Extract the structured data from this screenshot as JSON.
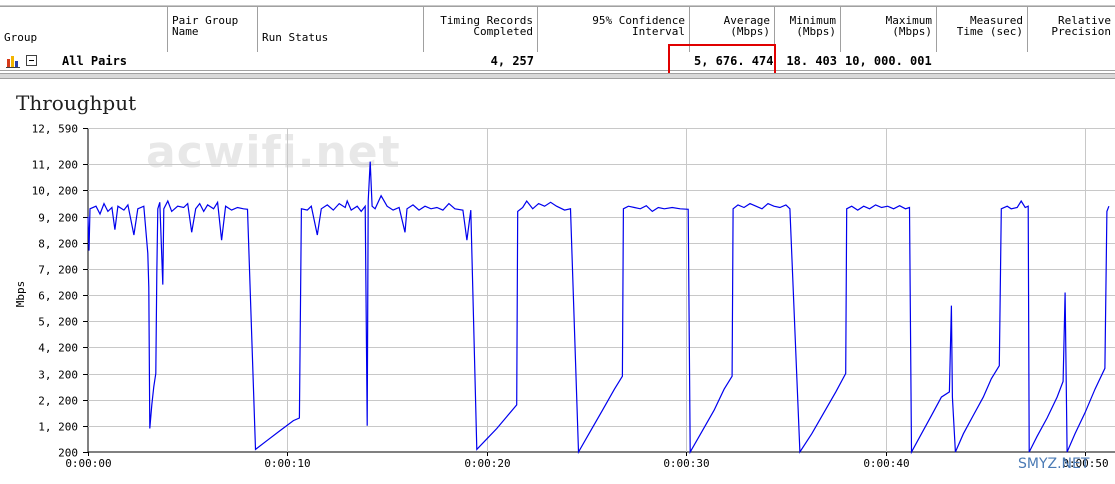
{
  "table": {
    "headers": [
      {
        "key": "group",
        "label": "Group",
        "align": "left",
        "valign": "bottom"
      },
      {
        "key": "pair_group_name",
        "label": "Pair Group\nName",
        "align": "left",
        "valign": "top"
      },
      {
        "key": "run_status",
        "label": "Run Status",
        "align": "left",
        "valign": "bottom"
      },
      {
        "key": "timing_records",
        "label": "Timing Records\nCompleted",
        "align": "right",
        "valign": "top"
      },
      {
        "key": "confidence",
        "label": "95% Confidence\nInterval",
        "align": "right",
        "valign": "top"
      },
      {
        "key": "average",
        "label": "Average\n(Mbps)",
        "align": "right",
        "valign": "top"
      },
      {
        "key": "minimum",
        "label": "Minimum\n(Mbps)",
        "align": "right",
        "valign": "top"
      },
      {
        "key": "maximum",
        "label": "Maximum\n(Mbps)",
        "align": "right",
        "valign": "top"
      },
      {
        "key": "measured_time",
        "label": "Measured\nTime (sec)",
        "align": "right",
        "valign": "top"
      },
      {
        "key": "relative_precision",
        "label": "Relative\nPrecision",
        "align": "right",
        "valign": "top"
      }
    ],
    "row": {
      "group": "All Pairs",
      "timing_records": "4, 257",
      "average": "5, 676. 474",
      "minimum": "18. 403",
      "maximum": "10, 000. 001"
    }
  },
  "chart_title": "Throughput",
  "watermark": "acwifi.net",
  "corner_mark": "SMYZ.NET",
  "colors": {
    "series": "#0000ee",
    "highlight": "#e00000",
    "grid": "#c8c8c8"
  },
  "chart_data": {
    "type": "line",
    "title": "Throughput",
    "ylabel": "Mbps",
    "xlabel": "",
    "ylim": [
      200,
      12590
    ],
    "xlim": [
      0,
      50
    ],
    "yticks": [
      200,
      1200,
      2200,
      3200,
      4200,
      5200,
      6200,
      7200,
      8200,
      9200,
      10200,
      11200,
      12590
    ],
    "ytick_labels": [
      "200",
      "1, 200",
      "2, 200",
      "3, 200",
      "4, 200",
      "5, 200",
      "6, 200",
      "7, 200",
      "8, 200",
      "9, 200",
      "10, 200",
      "11, 200",
      "12, 590"
    ],
    "xticks": [
      0,
      10,
      20,
      30,
      40,
      50
    ],
    "xtick_labels": [
      "0:00:00",
      "0:00:10",
      "0:00:20",
      "0:00:30",
      "0:00:40",
      "0:00:50"
    ],
    "grid": true,
    "series": [
      {
        "values": [
          [
            0,
            9200
          ],
          [
            0.05,
            7900
          ],
          [
            0.1,
            9500
          ],
          [
            0.4,
            9600
          ],
          [
            0.6,
            9300
          ],
          [
            0.8,
            9700
          ],
          [
            1.0,
            9400
          ],
          [
            1.2,
            9550
          ],
          [
            1.35,
            8700
          ],
          [
            1.5,
            9600
          ],
          [
            1.8,
            9450
          ],
          [
            2.0,
            9650
          ],
          [
            2.3,
            8500
          ],
          [
            2.5,
            9500
          ],
          [
            2.8,
            9600
          ],
          [
            3.0,
            7800
          ],
          [
            3.05,
            6500
          ],
          [
            3.1,
            1100
          ],
          [
            3.2,
            2000
          ],
          [
            3.3,
            2700
          ],
          [
            3.4,
            3200
          ],
          [
            3.45,
            7000
          ],
          [
            3.5,
            9500
          ],
          [
            3.6,
            9750
          ],
          [
            3.75,
            6600
          ],
          [
            3.8,
            9500
          ],
          [
            4.0,
            9800
          ],
          [
            4.2,
            9400
          ],
          [
            4.5,
            9600
          ],
          [
            4.8,
            9550
          ],
          [
            5.0,
            9700
          ],
          [
            5.2,
            8600
          ],
          [
            5.4,
            9500
          ],
          [
            5.6,
            9700
          ],
          [
            5.8,
            9400
          ],
          [
            6.0,
            9650
          ],
          [
            6.3,
            9500
          ],
          [
            6.5,
            9750
          ],
          [
            6.7,
            8300
          ],
          [
            6.9,
            9600
          ],
          [
            7.2,
            9450
          ],
          [
            7.5,
            9550
          ],
          [
            7.8,
            9500
          ],
          [
            8.0,
            9480
          ],
          [
            8.4,
            300
          ],
          [
            9.0,
            650
          ],
          [
            9.6,
            1000
          ],
          [
            10.3,
            1400
          ],
          [
            10.6,
            1500
          ],
          [
            10.7,
            9500
          ],
          [
            11.0,
            9450
          ],
          [
            11.2,
            9600
          ],
          [
            11.5,
            8500
          ],
          [
            11.7,
            9500
          ],
          [
            12.0,
            9650
          ],
          [
            12.3,
            9450
          ],
          [
            12.6,
            9700
          ],
          [
            12.9,
            9550
          ],
          [
            13.0,
            9800
          ],
          [
            13.2,
            9450
          ],
          [
            13.5,
            9600
          ],
          [
            13.7,
            9400
          ],
          [
            13.9,
            9600
          ],
          [
            14.0,
            1200
          ],
          [
            14.05,
            9800
          ],
          [
            14.15,
            11300
          ],
          [
            14.25,
            9600
          ],
          [
            14.4,
            9500
          ],
          [
            14.7,
            10000
          ],
          [
            15.0,
            9600
          ],
          [
            15.3,
            9450
          ],
          [
            15.6,
            9550
          ],
          [
            15.9,
            8600
          ],
          [
            16.0,
            9500
          ],
          [
            16.3,
            9650
          ],
          [
            16.6,
            9450
          ],
          [
            16.9,
            9600
          ],
          [
            17.2,
            9500
          ],
          [
            17.5,
            9550
          ],
          [
            17.8,
            9450
          ],
          [
            18.1,
            9700
          ],
          [
            18.4,
            9500
          ],
          [
            18.8,
            9450
          ],
          [
            19.0,
            8300
          ],
          [
            19.2,
            9450
          ],
          [
            19.5,
            300
          ],
          [
            20.0,
            700
          ],
          [
            20.5,
            1100
          ],
          [
            21.0,
            1550
          ],
          [
            21.5,
            2000
          ],
          [
            21.55,
            9400
          ],
          [
            21.8,
            9550
          ],
          [
            22.0,
            9800
          ],
          [
            22.3,
            9500
          ],
          [
            22.6,
            9700
          ],
          [
            22.9,
            9600
          ],
          [
            23.2,
            9750
          ],
          [
            23.5,
            9600
          ],
          [
            23.9,
            9450
          ],
          [
            24.2,
            9500
          ],
          [
            24.6,
            200
          ],
          [
            25.2,
            1000
          ],
          [
            25.8,
            1800
          ],
          [
            26.4,
            2600
          ],
          [
            26.8,
            3100
          ],
          [
            26.85,
            9500
          ],
          [
            27.1,
            9600
          ],
          [
            27.4,
            9550
          ],
          [
            27.7,
            9500
          ],
          [
            28.0,
            9620
          ],
          [
            28.3,
            9400
          ],
          [
            28.6,
            9550
          ],
          [
            28.9,
            9500
          ],
          [
            29.3,
            9550
          ],
          [
            29.7,
            9500
          ],
          [
            30.1,
            9480
          ],
          [
            30.2,
            200
          ],
          [
            30.8,
            1000
          ],
          [
            31.4,
            1800
          ],
          [
            31.9,
            2600
          ],
          [
            32.3,
            3100
          ],
          [
            32.35,
            9500
          ],
          [
            32.6,
            9650
          ],
          [
            32.9,
            9550
          ],
          [
            33.2,
            9700
          ],
          [
            33.5,
            9600
          ],
          [
            33.8,
            9500
          ],
          [
            34.1,
            9700
          ],
          [
            34.4,
            9600
          ],
          [
            34.7,
            9550
          ],
          [
            35.0,
            9650
          ],
          [
            35.2,
            9500
          ],
          [
            35.7,
            200
          ],
          [
            36.3,
            900
          ],
          [
            36.9,
            1700
          ],
          [
            37.5,
            2500
          ],
          [
            38.0,
            3200
          ],
          [
            38.05,
            9500
          ],
          [
            38.3,
            9600
          ],
          [
            38.6,
            9450
          ],
          [
            38.9,
            9600
          ],
          [
            39.2,
            9500
          ],
          [
            39.5,
            9650
          ],
          [
            39.8,
            9550
          ],
          [
            40.1,
            9600
          ],
          [
            40.4,
            9500
          ],
          [
            40.7,
            9620
          ],
          [
            41.0,
            9500
          ],
          [
            41.2,
            9550
          ],
          [
            41.3,
            200
          ],
          [
            41.8,
            900
          ],
          [
            42.3,
            1600
          ],
          [
            42.8,
            2300
          ],
          [
            43.2,
            2500
          ],
          [
            43.3,
            5800
          ],
          [
            43.35,
            2300
          ],
          [
            43.5,
            200
          ],
          [
            43.9,
            900
          ],
          [
            44.4,
            1600
          ],
          [
            44.9,
            2300
          ],
          [
            45.3,
            3000
          ],
          [
            45.7,
            3500
          ],
          [
            45.8,
            9500
          ],
          [
            46.1,
            9600
          ],
          [
            46.3,
            9500
          ],
          [
            46.6,
            9550
          ],
          [
            46.8,
            9800
          ],
          [
            47.0,
            9550
          ],
          [
            47.15,
            9600
          ],
          [
            47.2,
            200
          ],
          [
            47.6,
            800
          ],
          [
            48.1,
            1500
          ],
          [
            48.6,
            2300
          ],
          [
            48.9,
            2900
          ],
          [
            49.0,
            6300
          ],
          [
            49.1,
            200
          ],
          [
            49.5,
            900
          ],
          [
            50.0,
            1700
          ],
          [
            50.5,
            2600
          ],
          [
            51.0,
            3400
          ],
          [
            51.1,
            9400
          ],
          [
            51.2,
            9600
          ]
        ]
      }
    ]
  }
}
